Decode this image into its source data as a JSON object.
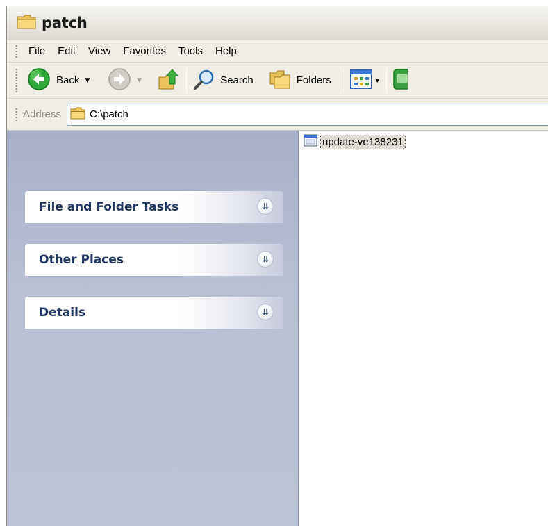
{
  "window": {
    "title": "patch"
  },
  "menu": {
    "file": "File",
    "edit": "Edit",
    "view": "View",
    "favorites": "Favorites",
    "tools": "Tools",
    "help": "Help"
  },
  "toolbar": {
    "back": "Back",
    "search": "Search",
    "folders": "Folders"
  },
  "address": {
    "label": "Address",
    "path": "C:\\patch"
  },
  "taskpane": {
    "groups": [
      "File and Folder Tasks",
      "Other Places",
      "Details"
    ]
  },
  "files": [
    {
      "name": "update-ve138231"
    }
  ],
  "colors": {
    "taskpane": "#b8bfd2",
    "title_text": "#213660",
    "accent": "#0055e5"
  }
}
